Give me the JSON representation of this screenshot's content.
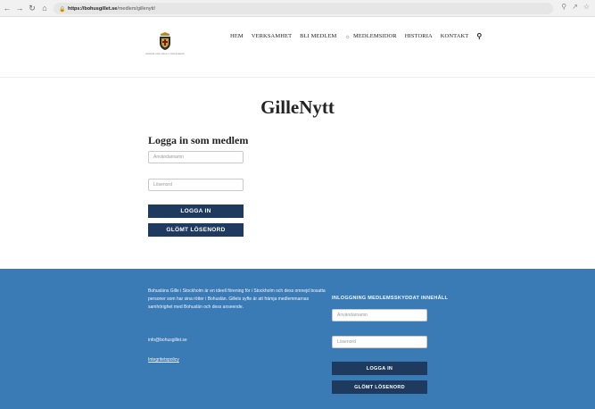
{
  "browser": {
    "url_host": "https://bohusgillet.se",
    "url_path": "/medlem/gillenytt/",
    "icons": [
      "back-icon",
      "forward-icon",
      "reload-icon",
      "home-icon",
      "lock-icon",
      "zoom-icon",
      "share-icon",
      "star-icon"
    ]
  },
  "header": {
    "logo_text": "BOHUSLÄNS GILLE I STOCKHOLM",
    "nav": {
      "hem": "HEM",
      "verksamhet": "VERKSAMHET",
      "bli_medlem": "BLI MEDLEM",
      "medlemsidor": "MEDLEMSIDOR",
      "historia": "HISTORIA",
      "kontakt": "KONTAKT"
    }
  },
  "main": {
    "title": "GilleNytt",
    "login_heading": "Logga in som medlem",
    "username_placeholder": "Användarnamn",
    "password_placeholder": "Lösenord",
    "login_button": "LOGGA IN",
    "forgot_button": "GLÖMT LÖSENORD"
  },
  "footer": {
    "description": "Bohusläns Gille i Stockholm är en ideell förening för i Stockholm och dess omnejd bosatta personer som har sina rötter i Bohuslän. Gillets syfte är att främja medlemmarnas samhörighet med Bohuslän och dess anseende.",
    "email": "info@bohusgillet.se",
    "policy_link": "Integritetspolicy",
    "login_heading": "INLOGGNING MEDLEMSSKYDDAT INNEHÅLL",
    "username_placeholder": "Användarnamn",
    "password_placeholder": "Lösenord",
    "login_button": "LOGGA IN",
    "forgot_button": "GLÖMT LÖSENORD"
  },
  "colors": {
    "footer_bg": "#3a7ab5",
    "button_bg": "#1e3a5f"
  }
}
